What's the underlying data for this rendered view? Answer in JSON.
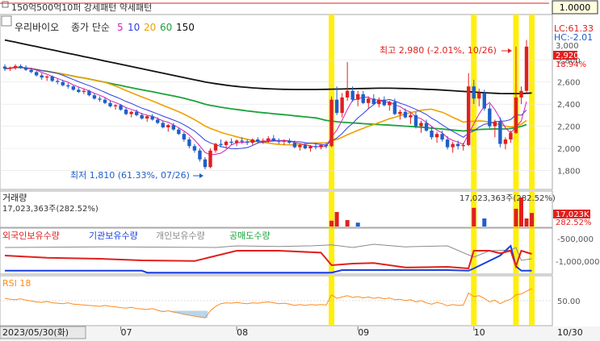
{
  "toolbar": {
    "title": "150억500억10퍼 강세패턴  약세패턴",
    "zoom_value": "1.0000"
  },
  "colors": {
    "up": "#e0201e",
    "down": "#1f5fc8",
    "ma5": "#d11fb5",
    "ma10": "#2f3fe0",
    "ma20": "#f0a000",
    "ma60": "#1aa33a",
    "ma150": "#111111",
    "signal": "#ffee00",
    "foreign": "#e0201e",
    "inst": "#1a3fe0",
    "retail": "#8a8a8a",
    "short": "#1aa33a",
    "rsi": "#ff8a1a"
  },
  "legend": {
    "stock_name": "우리바이오",
    "ma_title": "종가 단순",
    "periods": [
      "5",
      "10",
      "20",
      "60",
      "150"
    ]
  },
  "price_info": {
    "lc": "LC:61.33",
    "hc": "HC:-2.01",
    "y_top": "3,000",
    "current": "2,920",
    "pct": "18.94%"
  },
  "annotations": {
    "high": "최고 2,980 (-2.01%, 10/26)",
    "low": "최저 1,810 (61.33%, 07/26)",
    "vol_max": "17,023,363주(282.52%)"
  },
  "volume_panel": {
    "title": "거래량",
    "value": "17,023,363주(282.52%)",
    "badge": "17,023K",
    "pct": "282.52%"
  },
  "flow_panel": {
    "series": [
      "외국인보유수량",
      "기관보유수량",
      "개인보유수량",
      "공매도수량"
    ],
    "ticks": [
      "-500,000",
      "-1,000,000"
    ]
  },
  "rsi_panel": {
    "title": "RSI 18",
    "tick": "50.00"
  },
  "x_axis": {
    "start": "2023/05/30(화)",
    "months": [
      "07",
      "08",
      "09",
      "10"
    ],
    "end": "10/30"
  },
  "chart_data": {
    "type": "candlestick",
    "ylim": [
      1650,
      3050
    ],
    "yticks": [
      1800,
      2000,
      2200,
      2400,
      2600,
      2800
    ],
    "candles": [
      [
        2740,
        2760,
        2700,
        2720
      ],
      [
        2720,
        2740,
        2700,
        2730
      ],
      [
        2730,
        2760,
        2710,
        2745
      ],
      [
        2745,
        2760,
        2720,
        2730
      ],
      [
        2730,
        2750,
        2700,
        2710
      ],
      [
        2710,
        2730,
        2680,
        2690
      ],
      [
        2690,
        2700,
        2650,
        2660
      ],
      [
        2660,
        2680,
        2620,
        2640
      ],
      [
        2640,
        2660,
        2610,
        2650
      ],
      [
        2650,
        2660,
        2600,
        2610
      ],
      [
        2610,
        2630,
        2580,
        2600
      ],
      [
        2600,
        2620,
        2560,
        2570
      ],
      [
        2570,
        2590,
        2540,
        2560
      ],
      [
        2560,
        2570,
        2520,
        2530
      ],
      [
        2530,
        2550,
        2500,
        2510
      ],
      [
        2510,
        2540,
        2490,
        2520
      ],
      [
        2520,
        2530,
        2470,
        2480
      ],
      [
        2480,
        2500,
        2440,
        2450
      ],
      [
        2450,
        2470,
        2420,
        2440
      ],
      [
        2440,
        2460,
        2400,
        2410
      ],
      [
        2410,
        2430,
        2370,
        2380
      ],
      [
        2380,
        2400,
        2350,
        2390
      ],
      [
        2390,
        2400,
        2340,
        2350
      ],
      [
        2350,
        2370,
        2300,
        2310
      ],
      [
        2310,
        2340,
        2280,
        2330
      ],
      [
        2330,
        2350,
        2290,
        2300
      ],
      [
        2300,
        2320,
        2260,
        2270
      ],
      [
        2270,
        2300,
        2240,
        2290
      ],
      [
        2290,
        2310,
        2250,
        2260
      ],
      [
        2260,
        2280,
        2220,
        2230
      ],
      [
        2230,
        2250,
        2180,
        2190
      ],
      [
        2190,
        2220,
        2150,
        2210
      ],
      [
        2210,
        2230,
        2160,
        2170
      ],
      [
        2170,
        2190,
        2120,
        2130
      ],
      [
        2130,
        2150,
        2060,
        2080
      ],
      [
        2080,
        2100,
        2000,
        2020
      ],
      [
        2020,
        2040,
        1960,
        1980
      ],
      [
        1980,
        2000,
        1880,
        1900
      ],
      [
        1900,
        1920,
        1810,
        1830
      ],
      [
        1830,
        2000,
        1820,
        1980
      ],
      [
        1980,
        2050,
        1960,
        2040
      ],
      [
        2040,
        2080,
        2010,
        2030
      ],
      [
        2030,
        2070,
        2000,
        2060
      ],
      [
        2060,
        2090,
        2030,
        2050
      ],
      [
        2050,
        2080,
        2020,
        2070
      ],
      [
        2070,
        2100,
        2040,
        2060
      ],
      [
        2060,
        2080,
        2030,
        2050
      ],
      [
        2050,
        2090,
        2030,
        2080
      ],
      [
        2080,
        2100,
        2050,
        2060
      ],
      [
        2060,
        2090,
        2040,
        2070
      ],
      [
        2070,
        2110,
        2050,
        2090
      ],
      [
        2090,
        2120,
        2060,
        2070
      ],
      [
        2070,
        2090,
        2040,
        2060
      ],
      [
        2060,
        2080,
        2030,
        2070
      ],
      [
        2070,
        2090,
        2040,
        2050
      ],
      [
        2050,
        2070,
        2000,
        2010
      ],
      [
        2010,
        2040,
        1980,
        2030
      ],
      [
        2030,
        2050,
        1990,
        2000
      ],
      [
        2000,
        2030,
        1970,
        2020
      ],
      [
        2020,
        2050,
        1990,
        2010
      ],
      [
        2010,
        2040,
        1990,
        2030
      ],
      [
        2030,
        2050,
        2000,
        2020
      ],
      [
        2020,
        2470,
        2010,
        2440
      ],
      [
        2440,
        2560,
        2300,
        2320
      ],
      [
        2320,
        2500,
        2280,
        2460
      ],
      [
        2460,
        2780,
        2430,
        2520
      ],
      [
        2520,
        2560,
        2420,
        2440
      ],
      [
        2440,
        2520,
        2380,
        2490
      ],
      [
        2490,
        2520,
        2400,
        2410
      ],
      [
        2410,
        2470,
        2360,
        2450
      ],
      [
        2450,
        2490,
        2390,
        2400
      ],
      [
        2400,
        2460,
        2370,
        2440
      ],
      [
        2440,
        2470,
        2380,
        2390
      ],
      [
        2390,
        2430,
        2340,
        2420
      ],
      [
        2420,
        2450,
        2300,
        2310
      ],
      [
        2310,
        2350,
        2260,
        2330
      ],
      [
        2330,
        2360,
        2270,
        2280
      ],
      [
        2280,
        2320,
        2220,
        2300
      ],
      [
        2300,
        2330,
        2180,
        2200
      ],
      [
        2200,
        2250,
        2140,
        2230
      ],
      [
        2230,
        2260,
        2150,
        2160
      ],
      [
        2160,
        2200,
        2080,
        2100
      ],
      [
        2100,
        2150,
        2050,
        2130
      ],
      [
        2130,
        2160,
        2060,
        2080
      ],
      [
        2080,
        2110,
        1990,
        2010
      ],
      [
        2010,
        2060,
        1960,
        2040
      ],
      [
        2040,
        2070,
        1990,
        2020
      ],
      [
        2020,
        2050,
        1980,
        2030
      ],
      [
        2030,
        2680,
        2020,
        2560
      ],
      [
        2560,
        2620,
        2400,
        2450
      ],
      [
        2450,
        2540,
        2380,
        2500
      ],
      [
        2500,
        2530,
        2340,
        2360
      ],
      [
        2360,
        2400,
        2180,
        2200
      ],
      [
        2200,
        2260,
        2100,
        2240
      ],
      [
        2240,
        2280,
        2010,
        2040
      ],
      [
        2040,
        2100,
        1990,
        2080
      ],
      [
        2080,
        2160,
        2050,
        2140
      ],
      [
        2140,
        2920,
        2130,
        2460
      ],
      [
        2460,
        2560,
        2400,
        2520
      ],
      [
        2520,
        2980,
        2500,
        2920
      ]
    ],
    "ma150": [
      2980,
      2970,
      2960,
      2950,
      2940,
      2930,
      2920,
      2910,
      2900,
      2890,
      2880,
      2870,
      2860,
      2850,
      2840,
      2830,
      2820,
      2810,
      2800,
      2790,
      2780,
      2770,
      2760,
      2750,
      2740,
      2730,
      2720,
      2710,
      2700,
      2690,
      2680,
      2670,
      2660,
      2650,
      2640,
      2630,
      2620,
      2610,
      2600,
      2592,
      2585,
      2578,
      2571,
      2565,
      2560,
      2555,
      2551,
      2547,
      2544,
      2541,
      2539,
      2537,
      2535,
      2534,
      2533,
      2532,
      2532,
      2532,
      2532,
      2532,
      2533,
      2534,
      2535,
      2536,
      2537,
      2538,
      2539,
      2540,
      2541,
      2542,
      2543,
      2544,
      2544,
      2544,
      2543,
      2542,
      2541,
      2540,
      2538,
      2536,
      2534,
      2532,
      2530,
      2527,
      2524,
      2521,
      2518,
      2515,
      2512,
      2509,
      2506,
      2503,
      2500,
      2498,
      2496,
      2495,
      2495,
      2495,
      2496,
      2498,
      2500
    ],
    "volume_bars": [
      [
        62,
        0.18,
        "up"
      ],
      [
        63,
        0.45,
        "up"
      ],
      [
        65,
        0.2,
        "up"
      ],
      [
        67,
        0.12,
        "down"
      ],
      [
        89,
        0.58,
        "up"
      ],
      [
        91,
        0.25,
        "down"
      ],
      [
        97,
        0.55,
        "up"
      ],
      [
        98,
        0.9,
        "up"
      ],
      [
        99,
        0.25,
        "up"
      ],
      [
        100,
        0.42,
        "up"
      ]
    ],
    "signal_days": [
      62,
      89,
      97,
      100
    ],
    "flow_levels": {
      "foreign": [
        [
          0,
          0.45
        ],
        [
          8,
          0.52
        ],
        [
          18,
          0.55
        ],
        [
          26,
          0.6
        ],
        [
          36,
          0.62
        ],
        [
          44,
          0.3
        ],
        [
          52,
          0.3
        ],
        [
          60,
          0.36
        ],
        [
          62,
          0.75
        ],
        [
          66,
          0.7
        ],
        [
          70,
          0.68
        ],
        [
          76,
          0.82
        ],
        [
          84,
          0.8
        ],
        [
          88,
          0.85
        ],
        [
          89,
          0.3
        ],
        [
          92,
          0.3
        ],
        [
          94,
          0.38
        ],
        [
          96,
          0.3
        ],
        [
          97,
          0.78
        ],
        [
          98,
          0.3
        ],
        [
          100,
          0.4
        ]
      ],
      "institution": [
        [
          0,
          0.92
        ],
        [
          26,
          0.92
        ],
        [
          27,
          0.98
        ],
        [
          60,
          0.98
        ],
        [
          62,
          0.98
        ],
        [
          64,
          0.9
        ],
        [
          84,
          0.9
        ],
        [
          88,
          0.92
        ],
        [
          89,
          0.85
        ],
        [
          94,
          0.45
        ],
        [
          96,
          0.15
        ],
        [
          97,
          0.78
        ],
        [
          98,
          0.92
        ],
        [
          100,
          0.92
        ]
      ],
      "retail": [
        [
          0,
          0.2
        ],
        [
          20,
          0.18
        ],
        [
          40,
          0.2
        ],
        [
          44,
          0.15
        ],
        [
          52,
          0.17
        ],
        [
          58,
          0.15
        ],
        [
          62,
          0.12
        ],
        [
          66,
          0.2
        ],
        [
          70,
          0.1
        ],
        [
          76,
          0.18
        ],
        [
          84,
          0.15
        ],
        [
          89,
          0.5
        ],
        [
          92,
          0.3
        ],
        [
          96,
          0.28
        ],
        [
          97,
          0.2
        ],
        [
          98,
          0.6
        ],
        [
          100,
          0.55
        ]
      ]
    },
    "rsi": [
      58,
      56,
      55,
      57,
      54,
      52,
      50,
      49,
      51,
      48,
      47,
      46,
      48,
      45,
      44,
      43,
      42,
      41,
      40,
      42,
      40,
      39,
      37,
      36,
      38,
      35,
      34,
      33,
      35,
      31,
      28,
      30,
      27,
      25,
      22,
      20,
      18,
      16,
      14,
      30,
      40,
      46,
      48,
      47,
      49,
      47,
      46,
      48,
      47,
      49,
      50,
      48,
      46,
      47,
      45,
      42,
      44,
      42,
      44,
      43,
      44,
      43,
      66,
      58,
      61,
      64,
      60,
      62,
      59,
      61,
      58,
      60,
      57,
      59,
      55,
      56,
      53,
      55,
      50,
      53,
      48,
      45,
      49,
      46,
      41,
      44,
      42,
      43,
      70,
      62,
      64,
      58,
      50,
      54,
      46,
      52,
      56,
      66,
      68,
      74,
      80
    ]
  }
}
